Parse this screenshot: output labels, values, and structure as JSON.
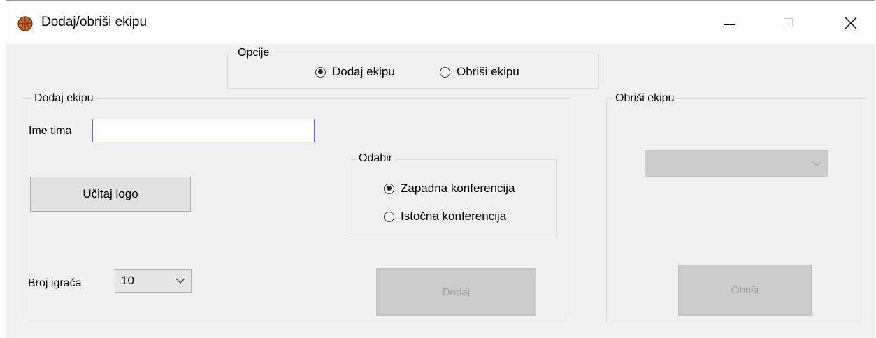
{
  "window": {
    "title": "Dodaj/obriši ekipu",
    "app_icon": "basketball-icon",
    "controls": {
      "minimize": "minimize-icon",
      "maximize": "maximize-icon",
      "close": "close-icon"
    }
  },
  "options_group": {
    "caption": "Opcije",
    "add_label": "Dodaj ekipu",
    "delete_label": "Obriši ekipu",
    "selected": "add"
  },
  "add_group": {
    "caption": "Dodaj ekipu",
    "team_name_label": "Ime tima",
    "team_name_value": "",
    "load_logo_label": "Učitaj logo",
    "players_label": "Broj igrača",
    "players_value": "10",
    "add_button_label": "Dodaj",
    "add_button_enabled": false,
    "conference": {
      "caption": "Odabir",
      "west_label": "Zapadna konferencija",
      "east_label": "Istočna konferencija",
      "selected": "west"
    }
  },
  "delete_group": {
    "caption": "Obriši ekipu",
    "team_select_value": "",
    "delete_button_label": "Obriši",
    "delete_button_enabled": false
  },
  "colors": {
    "window_bg": "#f0f0f0",
    "textbox_focus_border": "#3c7fd2",
    "basketball": "#c96a2b"
  }
}
